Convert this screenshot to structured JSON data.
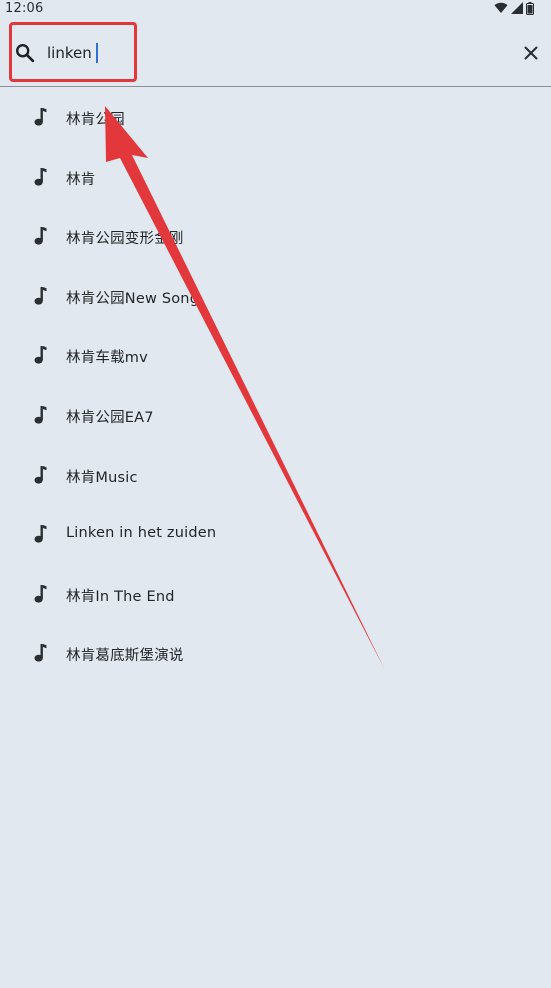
{
  "status_bar": {
    "time": "12:06",
    "icons": [
      "wifi-icon",
      "signal-icon",
      "battery-icon"
    ]
  },
  "search": {
    "query": "linken",
    "icon": "search-icon",
    "clear_icon": "close-icon"
  },
  "results": [
    {
      "label": "林肯公园",
      "icon": "music-note-icon"
    },
    {
      "label": "林肯",
      "icon": "music-note-icon"
    },
    {
      "label": "林肯公园变形金刚",
      "icon": "music-note-icon"
    },
    {
      "label": "林肯公园New Song",
      "icon": "music-note-icon"
    },
    {
      "label": "林肯车载mv",
      "icon": "music-note-icon"
    },
    {
      "label": "林肯公园EA7",
      "icon": "music-note-icon"
    },
    {
      "label": "林肯Music",
      "icon": "music-note-icon"
    },
    {
      "label": "Linken in het zuiden",
      "icon": "music-note-icon"
    },
    {
      "label": "林肯In The End",
      "icon": "music-note-icon"
    },
    {
      "label": "林肯葛底斯堡演说",
      "icon": "music-note-icon"
    }
  ],
  "colors": {
    "background": "#e2e8f0",
    "annotation": "#e2383c",
    "caret": "#2f6fd0"
  }
}
